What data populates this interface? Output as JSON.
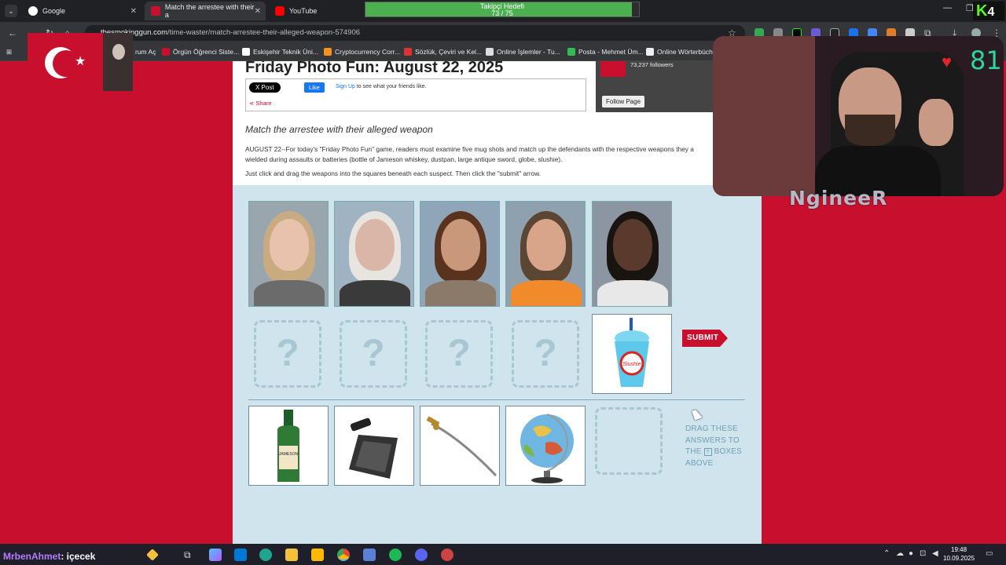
{
  "browser": {
    "tabs": [
      {
        "label": "Google"
      },
      {
        "label": "Match the arrestee with their a"
      },
      {
        "label": "YouTube"
      }
    ],
    "url_host": "thesmokinggun.com",
    "url_path": "/time-waster/match-arrestee-their-alleged-weapon-574906",
    "bookmarks": [
      "rum Aç",
      "Örgün Öğrenci Siste...",
      "Eskişehir Teknik Üni...",
      "Cryptocurrency Corr...",
      "Sözlük, Çeviri ve Kel...",
      "Online İşlemler - Tu...",
      "Posta - Mehmet Üm...",
      "Online Wörterbüche"
    ]
  },
  "overlay": {
    "follower_goal_title": "Takipçi Hedefi",
    "follower_goal_count": "73 / 75",
    "follower_goal_fraction": 0.973,
    "kick_count": "4",
    "heart_count": "81",
    "streamer_name": "NgineeR",
    "chat_user": "MrbenAhmet",
    "chat_message": ": içecek"
  },
  "page": {
    "headline": "Friday Photo Fun: August 22, 2025",
    "x_post": "X Post",
    "fb_like": "Like",
    "fb_signup": "Sign Up",
    "fb_signup_rest": "to see what your friends like.",
    "share": "Share",
    "fb_followers": "73,237 followers",
    "fb_follow": "Follow Page",
    "subhead": "Match the arrestee with their alleged weapon",
    "intro": "AUGUST 22--For today's \"Friday Photo Fun\" game, readers must examine five mug shots and match up the defendants with the respective weapons they a wielded during assaults or batteries (bottle of Jameson whiskey, dustpan, large antique sword, globe, slushie).",
    "instructions": "Just click and drag the weapons into the squares beneath each suspect. Then click the \"submit\" arrow.",
    "drop_mark": "?",
    "submit": "SUBMIT",
    "drag_note_1": "DRAG THESE ANSWERS TO THE",
    "drag_note_2": "BOXES ABOVE",
    "slushie_label": "Slushie",
    "whiskey_label": "JAMESON"
  },
  "mugshots": [
    {
      "name": "mugshot-1",
      "bg": "#9aa6ad",
      "skin": "#e9c2ad",
      "hair": "#c9ab82",
      "shirt": "#6b6b6b"
    },
    {
      "name": "mugshot-2",
      "bg": "#9fb3c2",
      "skin": "#d9b6a6",
      "hair": "#e8e4df",
      "shirt": "#3a3a3a"
    },
    {
      "name": "mugshot-3",
      "bg": "#8fa6b8",
      "skin": "#c9987a",
      "hair": "#5a331e",
      "shirt": "#8b7a6a"
    },
    {
      "name": "mugshot-4",
      "bg": "#8fa0ae",
      "skin": "#d9a58a",
      "hair": "#5b4634",
      "shirt": "#f08a2b"
    },
    {
      "name": "mugshot-5",
      "bg": "#8b96a2",
      "skin": "#5a3a2c",
      "hair": "#1a1411",
      "shirt": "#e8e8e8"
    }
  ],
  "taskbar": {
    "time": "19:48",
    "date": "10.09.2025"
  }
}
